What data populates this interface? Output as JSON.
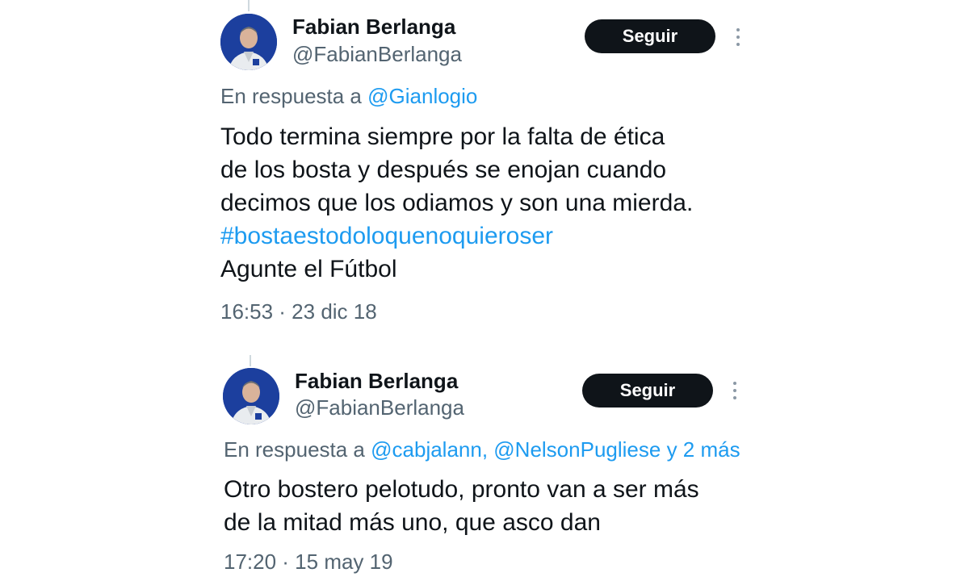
{
  "tweets": [
    {
      "author": {
        "name": "Fabian Berlanga",
        "handle": "@FabianBerlanga",
        "avatar_icon": "profile-photo"
      },
      "follow_label": "Seguir",
      "more_icon": "more-vertical-icon",
      "reply": {
        "prefix": "En respuesta a",
        "mentions": "@Gianlogio",
        "suffix": ""
      },
      "body": {
        "lines": [
          "Todo termina siempre por la falta de ética",
          "de los bosta y después se enojan cuando",
          "decimos que los odiamos y son una mierda."
        ],
        "hashtag": "#bostaestodoloquenoquieroser",
        "closing": "Agunte el Fútbol"
      },
      "timestamp": "16:53 · 23 dic 18"
    },
    {
      "author": {
        "name": "Fabian Berlanga",
        "handle": "@FabianBerlanga",
        "avatar_icon": "profile-photo"
      },
      "follow_label": "Seguir",
      "more_icon": "more-vertical-icon",
      "reply": {
        "prefix": "En respuesta a",
        "mentions": "@cabjalann, @NelsonPugliese",
        "suffix": "y 2 más"
      },
      "body": {
        "lines": [
          "Otro bostero pelotudo, pronto van a ser más",
          "de la mitad más uno, que asco dan"
        ]
      },
      "timestamp": "17:20 · 15 may 19"
    }
  ],
  "colors": {
    "text": "#0f1419",
    "secondary": "#536471",
    "link": "#1d9bf0",
    "button": "#0f1419"
  }
}
